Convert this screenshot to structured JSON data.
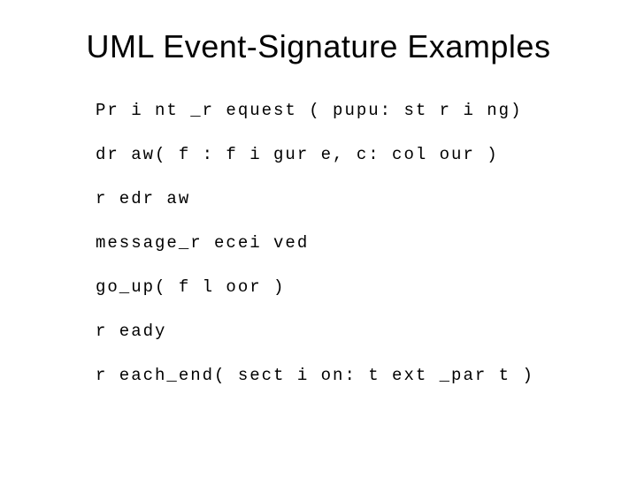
{
  "title": "UML Event-Signature Examples",
  "signatures": {
    "line1": "Pr i nt _r equest ( pupu: st r i ng)",
    "line2": "dr aw( f : f i gur e,  c: col our )",
    "line3": "r edr aw",
    "line4": "message_r ecei ved",
    "line5": "go_up( f l oor )",
    "line6": "r eady",
    "line7": "r each_end( sect i on: t ext _par t )"
  }
}
